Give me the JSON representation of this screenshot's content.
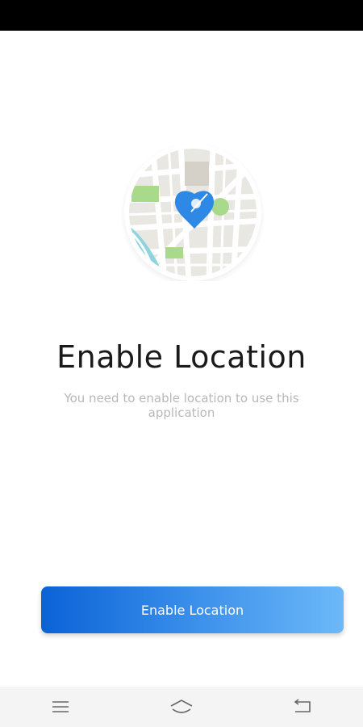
{
  "screen": {
    "title": "Enable Location",
    "message": "You need to enable location to use this application",
    "button_label": "Enable Location"
  },
  "illustration": {
    "icon": "map-location-pin-icon",
    "pin_color": "#2d88e6",
    "park_color": "#a9d98a",
    "water_color": "#8fd3de"
  },
  "navigation_bar": {
    "icons": [
      "menu-icon",
      "home-icon",
      "back-icon"
    ]
  },
  "colors": {
    "button_gradient_start": "#0b62d6",
    "button_gradient_end": "#6cb8f8",
    "title_color": "#1a1a1a",
    "message_color": "#b8b8b8",
    "status_bar": "#000000"
  }
}
